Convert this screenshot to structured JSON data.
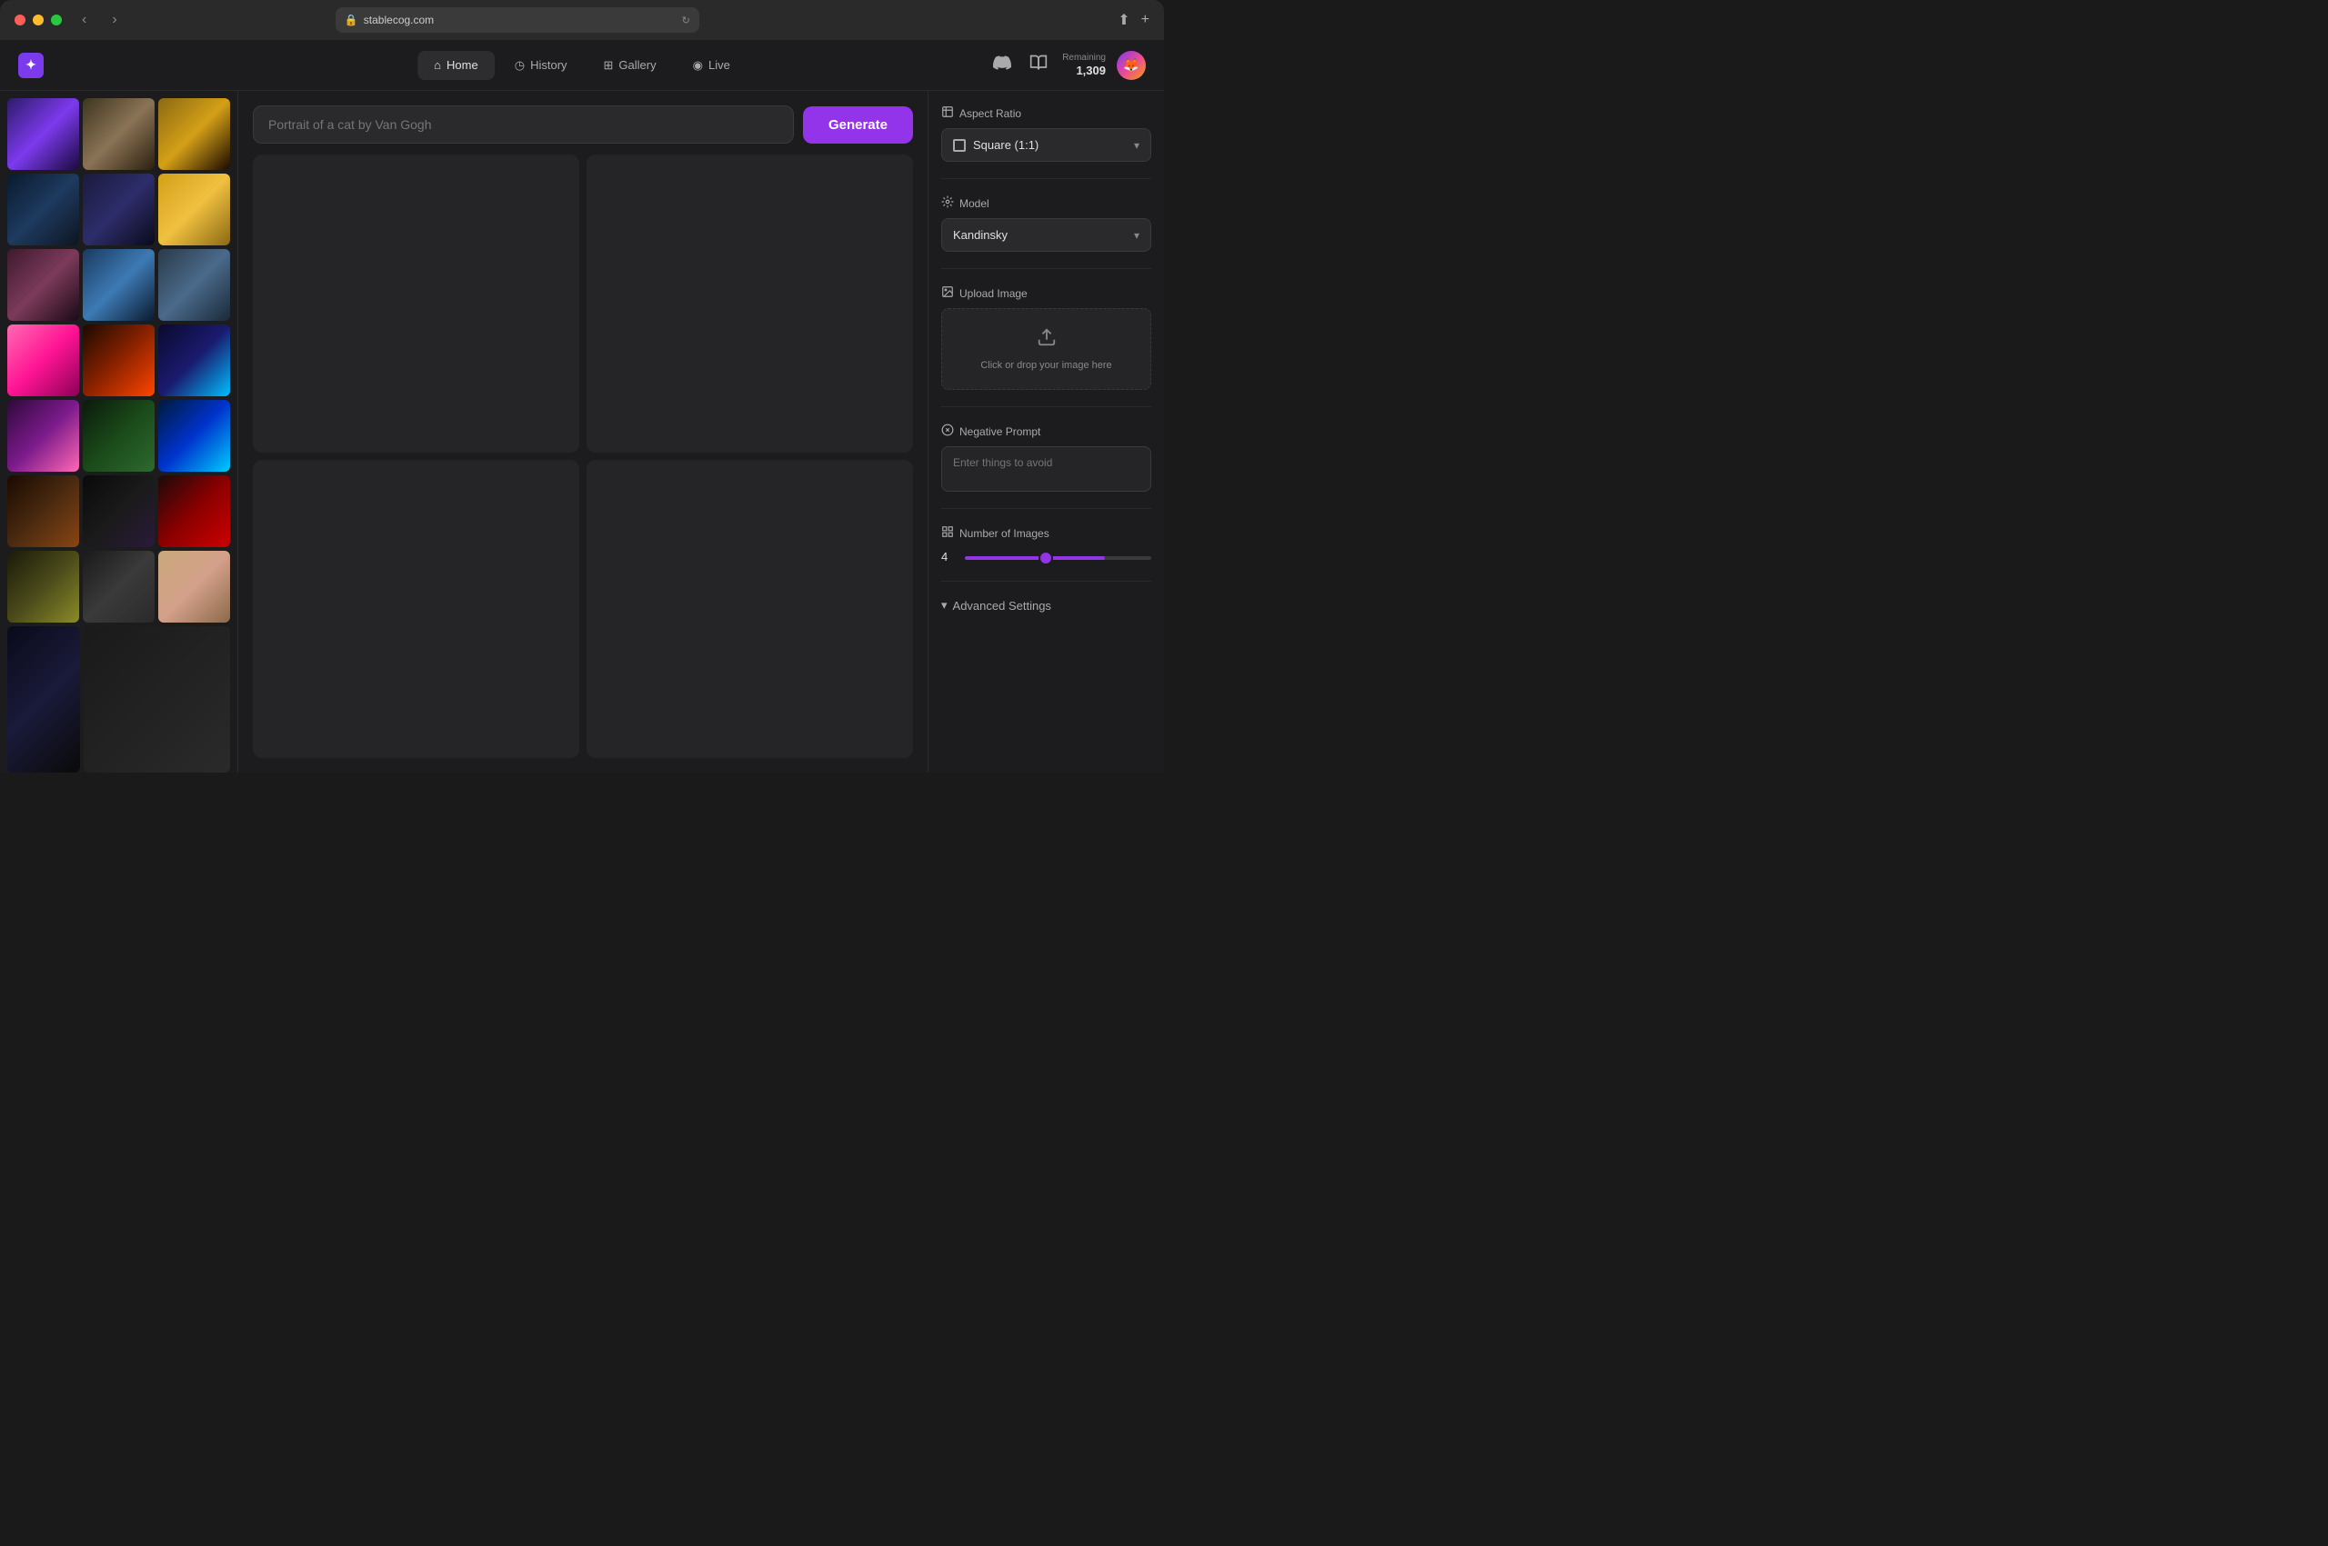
{
  "titlebar": {
    "url": "stablecog.com",
    "nav_back": "‹",
    "nav_forward": "›",
    "share_icon": "⬆",
    "new_tab_icon": "+"
  },
  "nav": {
    "logo": "✦",
    "tabs": [
      {
        "id": "home",
        "label": "Home",
        "icon": "⌂",
        "active": true
      },
      {
        "id": "history",
        "label": "History",
        "icon": "◷",
        "active": false
      },
      {
        "id": "gallery",
        "label": "Gallery",
        "icon": "⊞",
        "active": false
      },
      {
        "id": "live",
        "label": "Live",
        "icon": "◉",
        "active": false
      }
    ],
    "discord_icon": "discord",
    "book_icon": "📖",
    "remaining_label": "Remaining",
    "remaining_count": "1,309"
  },
  "prompt": {
    "placeholder": "Portrait of a cat by Van Gogh",
    "generate_label": "Generate"
  },
  "right_panel": {
    "aspect_ratio": {
      "label": "Aspect Ratio",
      "value": "Square (1:1)"
    },
    "model": {
      "label": "Model",
      "value": "Kandinsky"
    },
    "upload_image": {
      "label": "Upload Image",
      "drop_text": "Click or drop your image here"
    },
    "negative_prompt": {
      "label": "Negative Prompt",
      "placeholder": "Enter things to avoid"
    },
    "num_images": {
      "label": "Number of Images",
      "value": 4,
      "min": 1,
      "max": 8
    },
    "advanced_settings": {
      "label": "Advanced Settings"
    }
  },
  "gallery": {
    "images": [
      {
        "id": "purple-cat",
        "class": "img-purple-cat"
      },
      {
        "id": "plague",
        "class": "img-plague"
      },
      {
        "id": "golden-face",
        "class": "img-golden-face"
      },
      {
        "id": "dark-figure",
        "class": "img-dark-figure"
      },
      {
        "id": "bird",
        "class": "img-bird"
      },
      {
        "id": "pikachu",
        "class": "img-pikachu"
      },
      {
        "id": "anime-girl",
        "class": "img-anime-girl"
      },
      {
        "id": "car",
        "class": "img-car"
      },
      {
        "id": "raccoon",
        "class": "img-raccoon"
      },
      {
        "id": "flowers",
        "class": "img-flowers"
      },
      {
        "id": "volcano",
        "class": "img-volcano"
      },
      {
        "id": "neon",
        "class": "img-neon"
      },
      {
        "id": "flowers2",
        "class": "img-flowers2"
      },
      {
        "id": "forest",
        "class": "img-forest"
      },
      {
        "id": "crystal",
        "class": "img-crystal"
      },
      {
        "id": "pagoda",
        "class": "img-pagoda"
      },
      {
        "id": "demon",
        "class": "img-demon"
      },
      {
        "id": "woman-red",
        "class": "img-woman-red"
      },
      {
        "id": "snake",
        "class": "img-snake"
      },
      {
        "id": "portrait",
        "class": "img-portrait"
      },
      {
        "id": "anime-girl2",
        "class": "img-anime-girl2"
      },
      {
        "id": "dark-scene",
        "class": "img-dark-scene"
      }
    ]
  }
}
